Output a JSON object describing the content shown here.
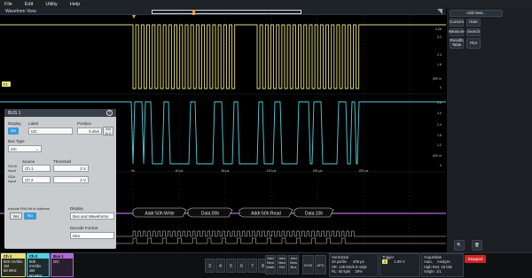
{
  "menu": [
    "File",
    "Edit",
    "Utility",
    "Help"
  ],
  "window": {
    "title": "Waveform View"
  },
  "scale": {
    "ch1": [
      "4.28",
      "3.2",
      "2.4",
      "1.6",
      "800 m",
      "0"
    ],
    "ch2": [
      "3.6",
      "3.0",
      "2.4",
      "1.8",
      "1.2",
      "600 m",
      "0"
    ]
  },
  "time_axis": [
    "0s",
    "40 µs",
    "80 µs",
    "120 µs",
    "160 µs",
    "200 µs"
  ],
  "bus": {
    "decodes": [
      "Addr:50h:Write",
      "Data:00h",
      "Addr:50h:Read",
      "Data:10h"
    ]
  },
  "dialog": {
    "title": "BUS 1",
    "display_label": "Display",
    "display_on": "On",
    "label_label": "Label",
    "label_value": "I2C",
    "position_label": "Position",
    "position_value": "0 divs",
    "set_to_0": "Set to 0",
    "bus_type_label": "Bus Type",
    "bus_type_value": "I2C",
    "source_label": "Source",
    "threshold_label": "Threshold",
    "sclk_label": "SCLK Input",
    "sclk_value": "Ch 1",
    "sclk_thresh": "2 V",
    "sda_label": "SDA Input",
    "sda_value": "Ch 2",
    "sda_thresh": "2 V",
    "rw_label": "Include R/W bit in Address",
    "yes": "Yes",
    "no": "No",
    "disp_label": "Display",
    "disp_value": "Bus and Waveforms",
    "decode_label": "Decode Format",
    "decode_value": "Hex"
  },
  "side": {
    "add_new": "Add New...",
    "cursors": "Cursors",
    "note": "Note",
    "measure": "Measure",
    "search": "Search",
    "results_table": "Results Table",
    "plot": "Plot"
  },
  "channels": [
    {
      "name": "Ch 1",
      "l1": "600 mV/div",
      "l2": "1M",
      "l3": "50 MHz",
      "color": "#e6e07a"
    },
    {
      "name": "Ch 2",
      "l1": "600 mV/div",
      "l2": "1M",
      "l3": "50 MHz",
      "color": "#4fd3e0"
    }
  ],
  "bus1": {
    "name": "Bus 1",
    "l1": "I2C",
    "color": "#b06ad6"
  },
  "num_buttons": [
    "3",
    "4",
    "5",
    "6",
    "7",
    "8"
  ],
  "add_buttons": [
    "Add New Math",
    "Add New Ref",
    "Add New Bus"
  ],
  "extra_buttons": [
    "DVM",
    "AFG"
  ],
  "horizontal": {
    "title": "Horizontal",
    "l1": "40 µs/div",
    "l2": "400 µs",
    "l3": "SR: 125 MS/s",
    "l4": "8 ns/pt",
    "l5": "RL: 50 kpts",
    "l6": "30%"
  },
  "trigger": {
    "title": "Trigger",
    "l1": "1",
    "l2": "1.99 V"
  },
  "acquisition": {
    "title": "Acquisition",
    "l1": "Auto,",
    "l2": "Analyze",
    "l3": "High Res: 16 bits",
    "l4": "Single: 1/1"
  },
  "stopped": "Stopped"
}
